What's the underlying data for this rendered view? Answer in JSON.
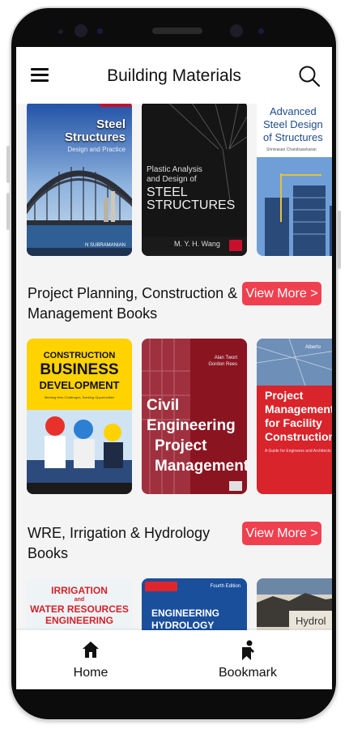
{
  "app": {
    "title": "Building Materials"
  },
  "sections": [
    {
      "title": null,
      "books": [
        {
          "tag": "",
          "title_lines": [
            "Steel",
            "Structures"
          ],
          "subtitle": "Design and Practice",
          "author": "N SUBRAMANIAN"
        },
        {
          "title_lines": [
            "Plastic Analysis",
            "and Design of",
            "STEEL",
            "STRUCTURES"
          ],
          "author": "M. Y. H. Wang"
        },
        {
          "title_lines": [
            "Advanced",
            "Steel Design",
            "of Structures"
          ],
          "author": "Srinivasan Chandrasekaran"
        }
      ]
    },
    {
      "title": "Project Planning, Construction & Management Books",
      "view_more": "View More >",
      "books": [
        {
          "title_lines": [
            "CONSTRUCTION",
            "BUSINESS",
            "DEVELOPMENT"
          ],
          "subtitle": "Meeting New Challenges, Seeking Opportunities"
        },
        {
          "authors": [
            "Alan Twort",
            "Gordon Rees"
          ],
          "title_lines": [
            "Civil",
            "Engineering",
            "Project",
            "Management"
          ]
        },
        {
          "author": "Alberto",
          "title_lines": [
            "Project",
            "Management",
            "for Facility",
            "Construction"
          ],
          "subtitle": "A Guide for Engineers and Architects"
        }
      ]
    },
    {
      "title": "WRE, Irrigation & Hydrology Books",
      "view_more": "View More >",
      "books": [
        {
          "title_lines": [
            "IRRIGATION",
            "and",
            "WATER RESOURCES",
            "ENGINEERING"
          ]
        },
        {
          "publisher": "",
          "edition": "Fourth Edition",
          "title_lines": [
            "ENGINEERING",
            "HYDROLOGY"
          ]
        },
        {
          "title_lines": [
            "Hydrol"
          ]
        }
      ]
    }
  ],
  "bottom_nav": [
    {
      "label": "Home",
      "icon": "home-icon"
    },
    {
      "label": "Bookmark",
      "icon": "bookmark-person-icon"
    }
  ],
  "colors": {
    "accent": "#ef4050",
    "appbar_bg": "#ffffff",
    "screen_bg": "#f4f4f4",
    "text": "#111111"
  }
}
